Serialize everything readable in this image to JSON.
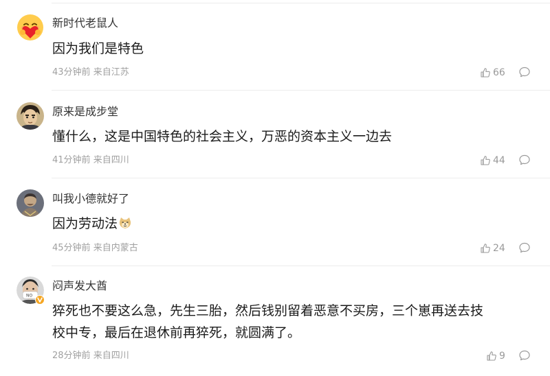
{
  "comments": [
    {
      "username": "新时代老鼠人",
      "text": "因为我们是特色",
      "time": "43分钟前",
      "location": "来自江苏",
      "likes": "66",
      "avatar_icon": "heart-hug-emoji"
    },
    {
      "username": "原来是成步堂",
      "text": "懂什么，这是中国特色的社会主义，万恶的资本主义一边去",
      "time": "41分钟前",
      "location": "来自四川",
      "likes": "44",
      "avatar_icon": "anime-character-avatar"
    },
    {
      "username": "叫我小德就好了",
      "text": "因为劳动法",
      "text_emoji": "doge-emoji",
      "time": "45分钟前",
      "location": "来自内蒙古",
      "likes": "24",
      "avatar_icon": "portrait-avatar"
    },
    {
      "username": "闷声发大酋",
      "text_line1": "猝死也不要这么急，先生三胎，然后钱别留着恶意不买房，三个崽再送去技",
      "text_line2": "校中专，最后在退休前再猝死，就圆满了。",
      "time": "28分钟前",
      "location": "来自四川",
      "likes": "9",
      "avatar_icon": "masked-person-avatar",
      "verified_badge": "verified-v-badge"
    }
  ],
  "colors": {
    "meta": "#a0a0a0",
    "divider": "#ececec",
    "verified": "#f5a623"
  }
}
